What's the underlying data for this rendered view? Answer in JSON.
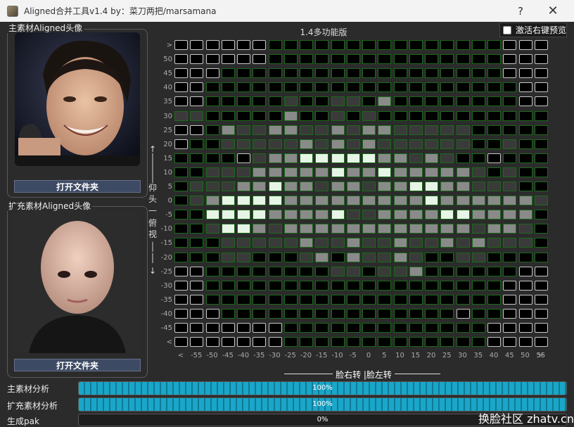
{
  "window": {
    "title": "Aligned合并工具v1.4  by：菜刀两把/marsamana",
    "help_glyph": "?",
    "close_glyph": "✕"
  },
  "main_panel": {
    "title": "主素材Aligned头像",
    "button": "打开文件夹"
  },
  "ext_panel": {
    "title": "扩充素材Aligned头像",
    "button": "打开文件夹"
  },
  "grid": {
    "title": "1.4多功能版",
    "right_preview_label": "激活右键预览",
    "top_glyph": ">",
    "bottom_glyph": "<",
    "row_labels": [
      "50",
      "45",
      "40",
      "35",
      "30",
      "25",
      "20",
      "15",
      "10",
      "5",
      "0",
      "-5",
      "-10",
      "-15",
      "-20",
      "-25",
      "-30",
      "-35",
      "-40",
      "-45"
    ],
    "left_glyph": "<",
    "right_glyph": ">",
    "col_labels": [
      "-55",
      "-50",
      "-45",
      "-40",
      "-35",
      "-30",
      "-25",
      "-20",
      "-15",
      "-10",
      "-5",
      "0",
      "5",
      "10",
      "15",
      "20",
      "25",
      "30",
      "35",
      "40",
      "45",
      "50",
      "55"
    ],
    "pitch_label": [
      "↑",
      "│",
      "│",
      "│",
      "仰",
      "头",
      "—",
      "俯",
      "视",
      "│",
      "│",
      "↓"
    ],
    "yaw_label": "脸右转 |脸左转",
    "cells": [
      "b,b,b,b,b,b,k,k,k,k,k,k,k,k,k,k,k,k,k,k,k,b,b,b",
      "b,b,b,b,b,b,k,k,k,k,k,k,k,k,k,k,k,k,k,k,k,b,b,b",
      "b,b,b,k,k,k,k,k,k,k,k,k,k,k,k,k,k,k,k,k,k,b,b,b",
      "b,b,k,k,k,k,k,k,k,k,k,k,k,k,k,k,k,k,k,k,k,k,b,b",
      "b,b,k,k,k,k,k,d,k,k,d,d,k,m,k,k,k,k,k,k,k,k,b,b",
      "d,d,k,k,k,k,k,m,k,k,d,k,d,k,k,k,k,k,k,k,k,k,k,k",
      "b,b,k,m,d,d,m,m,d,d,m,d,m,m,d,d,d,d,d,k,k,k,k,k",
      "b,k,k,d,d,d,d,d,m,d,m,d,m,d,d,d,d,d,d,k,k,d,k,k",
      "k,k,k,k,b,d,m,m,w,w,w,w,w,m,m,d,m,d,k,k,b,k,k,k",
      "k,k,d,d,d,m,m,m,m,m,w,m,m,w,m,m,m,m,m,d,k,d,k,k",
      "k,d,d,d,m,m,w,m,m,d,m,m,d,m,m,w,w,m,m,d,d,d,k,k",
      "k,d,m,w,w,w,w,m,m,m,m,m,m,m,m,m,w,m,m,m,m,m,m,d",
      "k,k,w,w,w,w,m,m,m,m,w,d,d,m,m,m,m,w,w,m,m,m,m,k",
      "k,k,d,w,w,m,d,m,m,m,m,m,m,m,m,m,m,m,m,d,m,m,d,k",
      "k,k,k,d,d,d,d,d,m,d,d,m,d,d,m,d,d,m,d,m,d,d,d,k",
      "k,k,k,d,d,k,k,k,d,m,k,m,d,d,m,d,k,k,d,d,k,k,k,k",
      "b,b,k,k,k,k,k,k,k,k,d,d,k,d,d,m,k,k,k,k,k,k,b,b",
      "b,b,k,k,k,k,k,k,k,k,k,k,k,k,k,k,k,k,k,k,k,b,b,b",
      "b,b,k,k,k,k,k,k,k,k,k,k,k,k,k,k,k,k,k,k,k,b,b,b",
      "b,b,b,k,k,k,k,k,k,k,k,k,k,k,k,k,k,k,b,k,k,b,b,b",
      "b,b,b,b,b,b,b,k,k,k,k,k,k,k,k,k,k,k,k,k,b,b,b,b",
      "b,b,b,b,b,b,b,k,k,k,k,k,k,k,k,k,k,k,k,k,b,b,b,b"
    ],
    "colors": {
      "b": "#000000",
      "k": "#000000",
      "d": "#3a3a3a",
      "m": "#8a8a8a",
      "w": "#e6f5e6"
    }
  },
  "progress": [
    {
      "label": "主素材分析",
      "percent": 100,
      "text": "100%"
    },
    {
      "label": "扩充素材分析",
      "percent": 100,
      "text": "100%"
    },
    {
      "label": "生成pak",
      "percent": 0,
      "text": "0%"
    }
  ],
  "watermark": "换脸社区 zhatv.cn",
  "colors": {
    "accent": "#1aa6c8",
    "grid_border_active": "#1a6a1a",
    "grid_border_edge": "#c8c8c8",
    "button_bg": "#3d4a63"
  }
}
